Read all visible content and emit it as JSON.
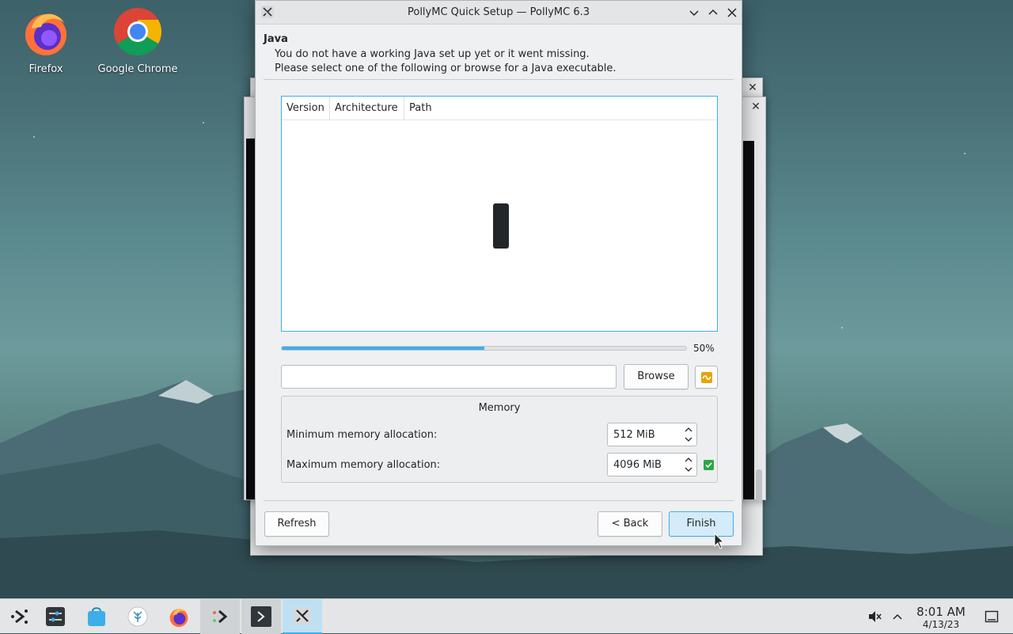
{
  "desktop": {
    "icons": [
      {
        "label": "Firefox",
        "icon": "firefox-icon"
      },
      {
        "label": "Google Chrome",
        "icon": "chrome-icon"
      }
    ]
  },
  "dialog": {
    "title": "PollyMC Quick Setup — PollyMC 6.3",
    "section_heading": "Java",
    "description_line1": "You do not have a working Java set up yet or it went missing.",
    "description_line2": "Please select one of the following or browse for a Java executable.",
    "table": {
      "columns": [
        "Version",
        "Architecture",
        "Path"
      ],
      "rows": []
    },
    "progress": {
      "value": 50,
      "label": "50%"
    },
    "java_path": {
      "value": "",
      "placeholder": ""
    },
    "browse_label": "Browse",
    "memory": {
      "title": "Memory",
      "min_label": "Minimum memory allocation:",
      "min_value": "512 MiB",
      "max_label": "Maximum memory allocation:",
      "max_value": "4096 MiB",
      "max_ok": true
    },
    "buttons": {
      "refresh": "Refresh",
      "back": "< Back",
      "finish": "Finish"
    }
  },
  "taskbar": {
    "items": [
      "application-launcher-icon",
      "system-settings-icon",
      "discover-icon",
      "kde-connect-icon",
      "firefox-icon",
      "pollymc-launcher-icon",
      "terminal-icon",
      "pollymc-icon"
    ],
    "tray": [
      "volume-muted-icon",
      "tray-expand-icon"
    ],
    "clock": {
      "time": "8:01 AM",
      "date": "4/13/23"
    },
    "show_desktop_icon": "show-desktop-icon"
  },
  "colors": {
    "accent": "#3daee9",
    "progress": "#3daee9",
    "ok_check": "#2fa548",
    "warning_icon": "#e5a50a"
  }
}
